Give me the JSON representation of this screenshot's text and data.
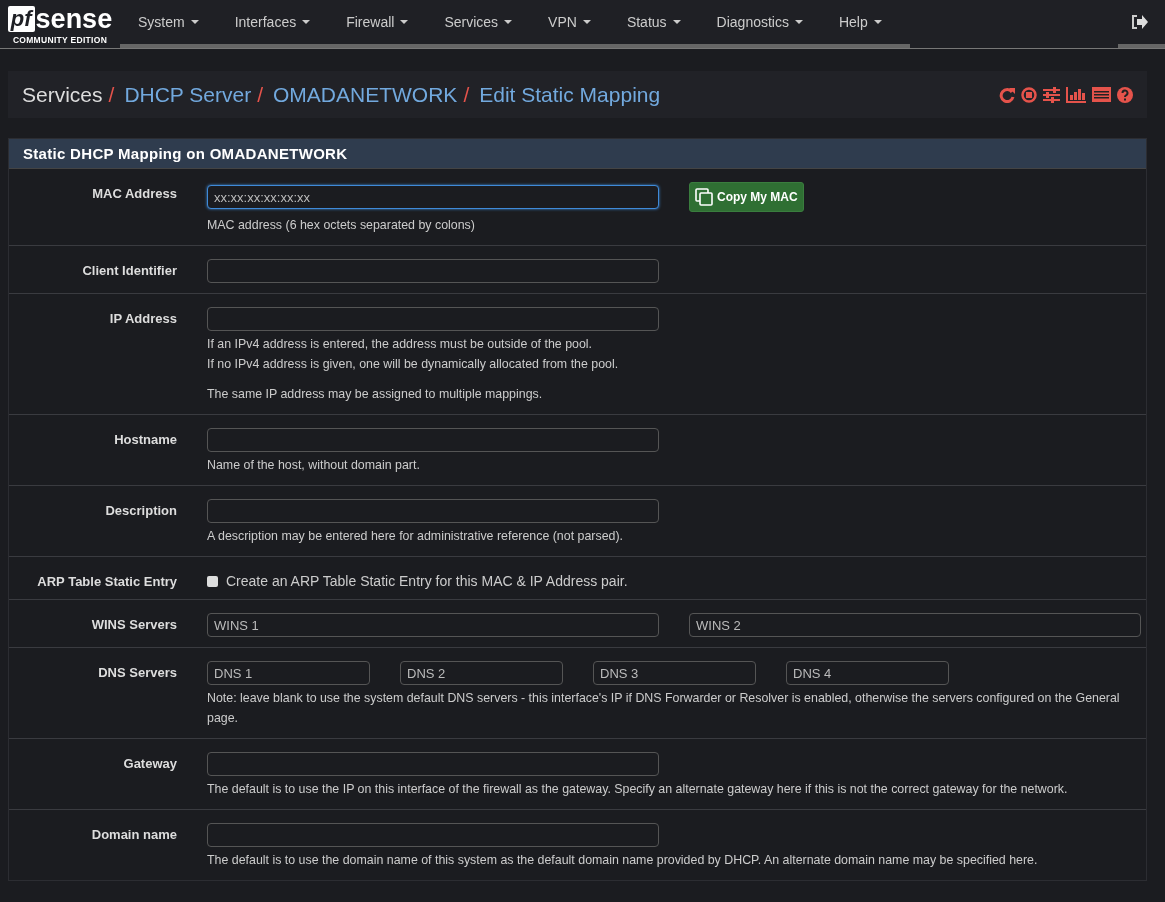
{
  "brand": {
    "logo_mark": "pf",
    "logo_word": "sense",
    "edition": "COMMUNITY EDITION"
  },
  "menu": [
    {
      "label": "System"
    },
    {
      "label": "Interfaces"
    },
    {
      "label": "Firewall"
    },
    {
      "label": "Services"
    },
    {
      "label": "VPN"
    },
    {
      "label": "Status"
    },
    {
      "label": "Diagnostics"
    },
    {
      "label": "Help"
    }
  ],
  "breadcrumb": [
    {
      "label": "Services",
      "link": false,
      "separator": "/"
    },
    {
      "label": "DHCP Server",
      "link": true,
      "separator": "/"
    },
    {
      "label": "OMADANETWORK",
      "link": true,
      "separator": "/"
    },
    {
      "label": "Edit Static Mapping",
      "link": true
    }
  ],
  "panel": {
    "title": "Static DHCP Mapping on OMADANETWORK",
    "rows": [
      {
        "label": "MAC Address",
        "kind": "inputs",
        "fields": [
          {
            "placeholder": "xx:xx:xx:xx:xx:xx",
            "kind": "wide",
            "focused": true
          }
        ],
        "button": {
          "label": "Copy My MAC"
        },
        "help": [
          "MAC address (6 hex octets separated by colons)"
        ]
      },
      {
        "label": "Client Identifier",
        "kind": "inputs",
        "fields": [
          {
            "kind": "wide",
            "focused": false
          }
        ]
      },
      {
        "label": "IP Address",
        "kind": "inputs",
        "fields": [
          {
            "kind": "wide",
            "focused": false
          }
        ],
        "help": [
          "If an IPv4 address is entered, the address must be outside of the pool.\nIf no IPv4 address is given, one will be dynamically allocated from the pool.",
          "The same IP address may be assigned to multiple mappings."
        ]
      },
      {
        "label": "Hostname",
        "kind": "inputs",
        "fields": [
          {
            "kind": "wide",
            "focused": false
          }
        ],
        "help": [
          "Name of the host, without domain part."
        ]
      },
      {
        "label": "Description",
        "kind": "inputs",
        "fields": [
          {
            "kind": "wide",
            "focused": false
          }
        ],
        "help": [
          "A description may be entered here for administrative reference (not parsed)."
        ]
      },
      {
        "label": "ARP Table Static Entry",
        "kind": "checkbox",
        "checked": false,
        "text": "Create an ARP Table Static Entry for this MAC & IP Address pair."
      },
      {
        "label": "WINS Servers",
        "kind": "inputs",
        "fields": [
          {
            "placeholder": "WINS 1",
            "kind": "half",
            "focused": false
          },
          {
            "placeholder": "WINS 2",
            "kind": "half",
            "focused": false
          }
        ]
      },
      {
        "label": "DNS Servers",
        "kind": "inputs",
        "fields": [
          {
            "placeholder": "DNS 1",
            "kind": "quarter",
            "focused": false
          },
          {
            "placeholder": "DNS 2",
            "kind": "quarter",
            "focused": false
          },
          {
            "placeholder": "DNS 3",
            "kind": "quarter",
            "focused": false
          },
          {
            "placeholder": "DNS 4",
            "kind": "quarter",
            "focused": false
          }
        ],
        "help": [
          "Note: leave blank to use the system default DNS servers - this interface's IP if DNS Forwarder or Resolver is enabled, otherwise the servers configured on the General page."
        ]
      },
      {
        "label": "Gateway",
        "kind": "inputs",
        "fields": [
          {
            "kind": "wide",
            "focused": false
          }
        ],
        "help": [
          "The default is to use the IP on this interface of the firewall as the gateway. Specify an alternate gateway here if this is not the correct gateway for the network."
        ]
      },
      {
        "label": "Domain name",
        "kind": "inputs",
        "fields": [
          {
            "kind": "wide",
            "focused": false
          }
        ],
        "help": [
          "The default is to use the domain name of this system as the default domain name provided by DHCP. An alternate domain name may be specified here."
        ]
      }
    ]
  }
}
